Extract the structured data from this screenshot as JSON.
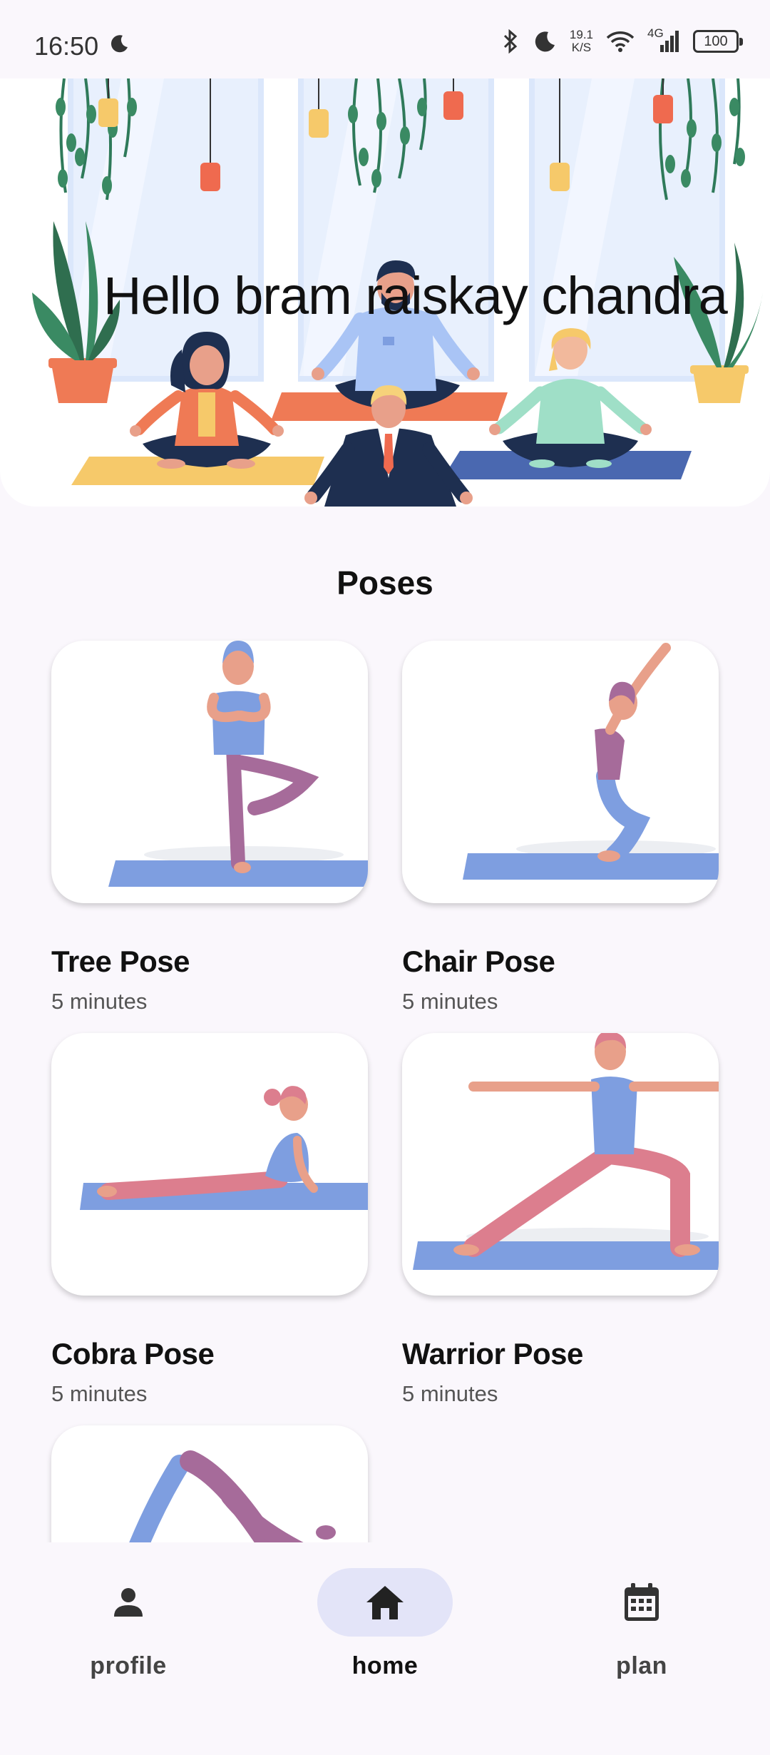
{
  "status_bar": {
    "time": "16:50",
    "speed_value": "19.1",
    "speed_unit": "K/S",
    "network": "4G",
    "battery": "100"
  },
  "hero": {
    "greeting": "Hello  bram raiskay chandra"
  },
  "poses_section": {
    "title": "Poses",
    "items": [
      {
        "name": "Tree Pose",
        "duration": "5 minutes"
      },
      {
        "name": "Chair Pose",
        "duration": "5 minutes"
      },
      {
        "name": "Cobra Pose",
        "duration": "5 minutes"
      },
      {
        "name": "Warrior Pose",
        "duration": "5 minutes"
      }
    ]
  },
  "bottom_nav": {
    "items": [
      {
        "label": "profile",
        "icon": "person-icon",
        "active": false
      },
      {
        "label": "home",
        "icon": "home-icon",
        "active": true
      },
      {
        "label": "plan",
        "icon": "calendar-icon",
        "active": false
      }
    ]
  },
  "colors": {
    "background": "#faf7fc",
    "nav_active_pill": "#e3e4f8",
    "mat_blue": "#7e9ee0",
    "skin": "#e8a08a"
  }
}
